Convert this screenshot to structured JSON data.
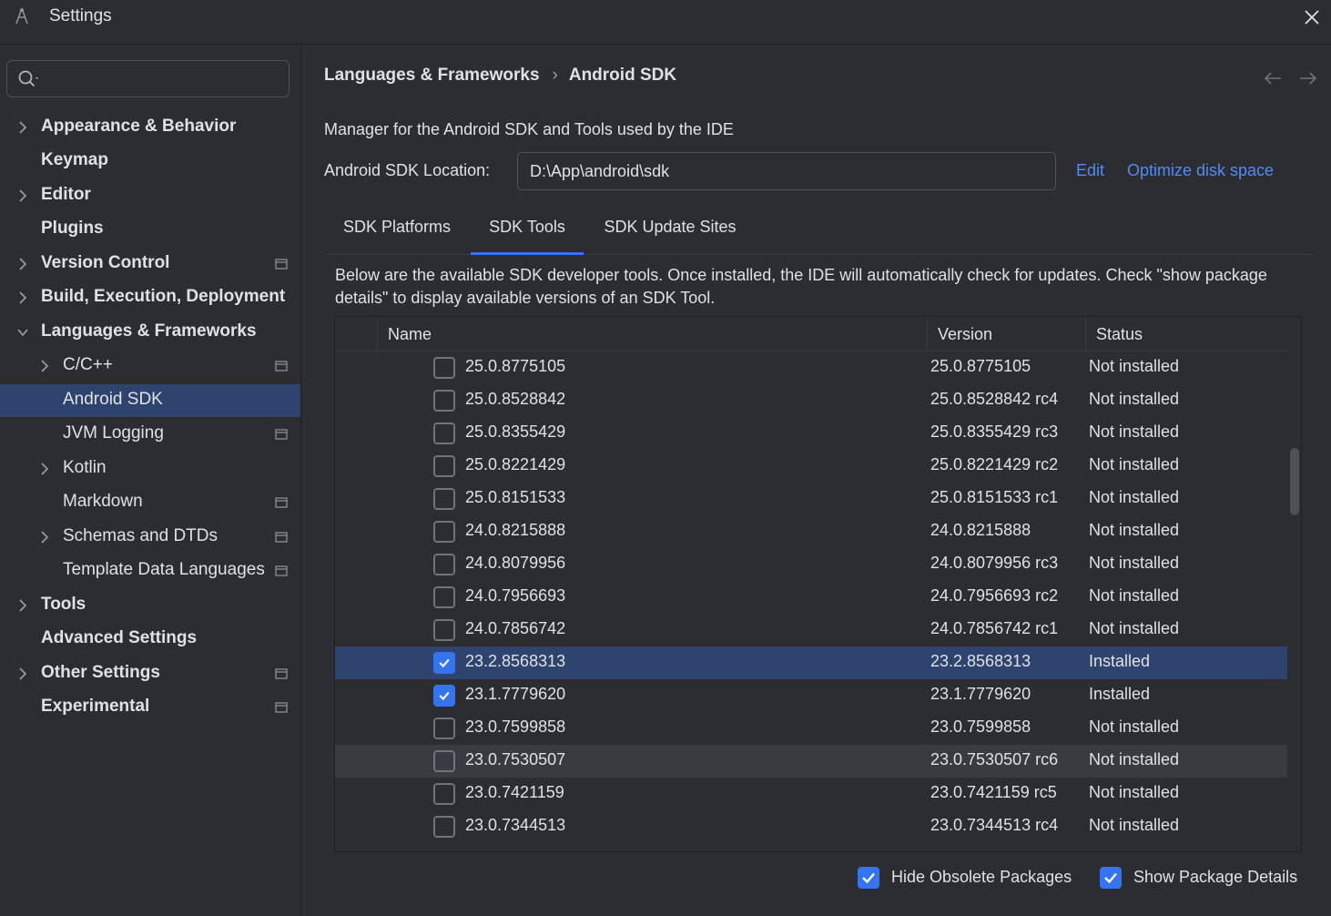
{
  "window": {
    "title": "Settings"
  },
  "search": {
    "placeholder": "",
    "value": ""
  },
  "sidebar": {
    "items": [
      {
        "label": "Appearance & Behavior"
      },
      {
        "label": "Keymap"
      },
      {
        "label": "Editor"
      },
      {
        "label": "Plugins"
      },
      {
        "label": "Version Control"
      },
      {
        "label": "Build, Execution, Deployment"
      },
      {
        "label": "Languages & Frameworks"
      },
      {
        "label": "C/C++"
      },
      {
        "label": "Android SDK"
      },
      {
        "label": "JVM Logging"
      },
      {
        "label": "Kotlin"
      },
      {
        "label": "Markdown"
      },
      {
        "label": "Schemas and DTDs"
      },
      {
        "label": "Template Data Languages"
      },
      {
        "label": "Tools"
      },
      {
        "label": "Advanced Settings"
      },
      {
        "label": "Other Settings"
      },
      {
        "label": "Experimental"
      }
    ]
  },
  "breadcrumb": {
    "parent": "Languages & Frameworks",
    "separator": "›",
    "current": "Android SDK"
  },
  "page": {
    "description": "Manager for the Android SDK and Tools used by the IDE",
    "sdk_location_label": "Android SDK Location:",
    "sdk_location_value": "D:\\App\\android\\sdk",
    "edit_link": "Edit",
    "optimize_link": "Optimize disk space"
  },
  "tabs": [
    {
      "label": "SDK Platforms"
    },
    {
      "label": "SDK Tools"
    },
    {
      "label": "SDK Update Sites"
    }
  ],
  "tools_description": "Below are the available SDK developer tools. Once installed, the IDE will automatically check for updates. Check \"show package details\" to display available versions of an SDK Tool.",
  "table": {
    "headers": {
      "name": "Name",
      "version": "Version",
      "status": "Status"
    },
    "rows": [
      {
        "name": "25.0.8775105",
        "version": "25.0.8775105",
        "status": "Not installed",
        "checked": false
      },
      {
        "name": "25.0.8528842",
        "version": "25.0.8528842 rc4",
        "status": "Not installed",
        "checked": false
      },
      {
        "name": "25.0.8355429",
        "version": "25.0.8355429 rc3",
        "status": "Not installed",
        "checked": false
      },
      {
        "name": "25.0.8221429",
        "version": "25.0.8221429 rc2",
        "status": "Not installed",
        "checked": false
      },
      {
        "name": "25.0.8151533",
        "version": "25.0.8151533 rc1",
        "status": "Not installed",
        "checked": false
      },
      {
        "name": "24.0.8215888",
        "version": "24.0.8215888",
        "status": "Not installed",
        "checked": false
      },
      {
        "name": "24.0.8079956",
        "version": "24.0.8079956 rc3",
        "status": "Not installed",
        "checked": false
      },
      {
        "name": "24.0.7956693",
        "version": "24.0.7956693 rc2",
        "status": "Not installed",
        "checked": false
      },
      {
        "name": "24.0.7856742",
        "version": "24.0.7856742 rc1",
        "status": "Not installed",
        "checked": false
      },
      {
        "name": "23.2.8568313",
        "version": "23.2.8568313",
        "status": "Installed",
        "checked": true
      },
      {
        "name": "23.1.7779620",
        "version": "23.1.7779620",
        "status": "Installed",
        "checked": true
      },
      {
        "name": "23.0.7599858",
        "version": "23.0.7599858",
        "status": "Not installed",
        "checked": false
      },
      {
        "name": "23.0.7530507",
        "version": "23.0.7530507 rc6",
        "status": "Not installed",
        "checked": false
      },
      {
        "name": "23.0.7421159",
        "version": "23.0.7421159 rc5",
        "status": "Not installed",
        "checked": false
      },
      {
        "name": "23.0.7344513",
        "version": "23.0.7344513 rc4",
        "status": "Not installed",
        "checked": false
      }
    ]
  },
  "footer": {
    "hide_obsolete_label": "Hide Obsolete Packages",
    "hide_obsolete_checked": true,
    "show_details_label": "Show Package Details",
    "show_details_checked": true
  },
  "colors": {
    "background": "#2b2d30",
    "selection": "#2e436e",
    "accent": "#3574f0",
    "link": "#548af7",
    "text": "#dfe1e5"
  }
}
